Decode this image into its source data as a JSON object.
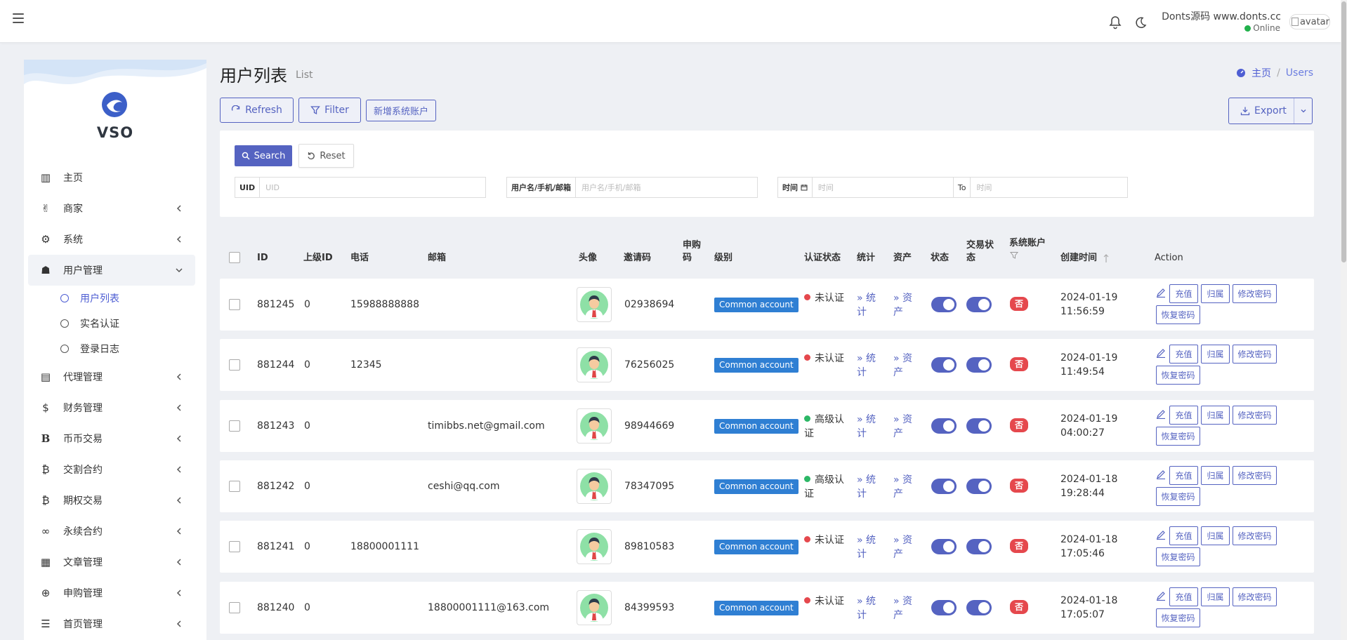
{
  "topbar": {
    "user_name": "Donts源码 www.donts.cc",
    "status": "Online",
    "avatar_alt": "avatar"
  },
  "sidebar": {
    "brand": "VSO",
    "items": [
      {
        "label": "主页",
        "icon": "chart-bar-icon",
        "glyph": "▥",
        "chevron": false
      },
      {
        "label": "商家",
        "icon": "handshake-icon",
        "glyph": "✌",
        "chevron": true
      },
      {
        "label": "系统",
        "icon": "gear-icon",
        "glyph": "⚙",
        "chevron": true
      },
      {
        "label": "用户管理",
        "icon": "users-icon",
        "glyph": "☗",
        "chevron": true,
        "expanded": true
      },
      {
        "label": "代理管理",
        "icon": "id-card-icon",
        "glyph": "▤",
        "chevron": true
      },
      {
        "label": "财务管理",
        "icon": "dollar-icon",
        "glyph": "$",
        "chevron": true
      },
      {
        "label": "币币交易",
        "icon": "bitcoin-b-icon",
        "glyph": "B",
        "chevron": true
      },
      {
        "label": "交割合约",
        "icon": "bitcoin-icon",
        "glyph": "₿",
        "chevron": true
      },
      {
        "label": "期权交易",
        "icon": "bitcoin-icon",
        "glyph": "₿",
        "chevron": true
      },
      {
        "label": "永续合约",
        "icon": "link-icon",
        "glyph": "∞",
        "chevron": true
      },
      {
        "label": "文章管理",
        "icon": "newspaper-icon",
        "glyph": "▦",
        "chevron": true
      },
      {
        "label": "申购管理",
        "icon": "lifebuoy-icon",
        "glyph": "⊕",
        "chevron": true
      },
      {
        "label": "首页管理",
        "icon": "list-icon",
        "glyph": "☰",
        "chevron": true
      }
    ],
    "submenu": [
      {
        "label": "用户列表",
        "active": true
      },
      {
        "label": "实名认证",
        "active": false
      },
      {
        "label": "登录日志",
        "active": false
      }
    ]
  },
  "header": {
    "title": "用户列表",
    "subtitle": "List",
    "breadcrumb_home": "主页",
    "breadcrumb_current": "Users"
  },
  "toolbar": {
    "refresh": "Refresh",
    "filter": "Filter",
    "new_system_account": "新增系统账户",
    "export": "Export"
  },
  "search": {
    "search_btn": "Search",
    "reset_btn": "Reset",
    "uid_label": "UID",
    "uid_placeholder": "UID",
    "user_label": "用户名/手机/邮箱",
    "user_placeholder": "用户名/手机/邮箱",
    "time_label": "时间",
    "time_placeholder": "时间",
    "to_label": "To",
    "to_placeholder": "时间"
  },
  "table": {
    "headers": {
      "id": "ID",
      "parent_id": "上级ID",
      "phone": "电话",
      "email": "邮箱",
      "avatar": "头像",
      "invite": "邀请码",
      "purchase": "申购码",
      "level": "级别",
      "auth": "认证状态",
      "stats": "统计",
      "assets": "资产",
      "status": "状态",
      "trade_status": "交易状态",
      "sys_account": "系统账户",
      "created": "创建时间",
      "action": "Action"
    },
    "actions": {
      "recharge": "充值",
      "belong": "归属",
      "change_pwd": "修改密码",
      "restore_pwd": "恢复密码",
      "stats": "统计",
      "assets": "资产"
    },
    "rows": [
      {
        "id": "881245",
        "parent": "0",
        "phone": "15988888888",
        "email": "",
        "invite": "02938694",
        "level": "Common account",
        "auth": "未认证",
        "auth_color": "#e5484d",
        "sys": "否",
        "date": "2024-01-19",
        "time": "11:56:59"
      },
      {
        "id": "881244",
        "parent": "0",
        "phone": "12345",
        "email": "",
        "invite": "76256025",
        "level": "Common account",
        "auth": "未认证",
        "auth_color": "#e5484d",
        "sys": "否",
        "date": "2024-01-19",
        "time": "11:49:54"
      },
      {
        "id": "881243",
        "parent": "0",
        "phone": "",
        "email": "timibbs.net@gmail.com",
        "invite": "98944669",
        "level": "Common account",
        "auth": "高级认证",
        "auth_color": "#2cb766",
        "sys": "否",
        "date": "2024-01-19",
        "time": "04:00:27"
      },
      {
        "id": "881242",
        "parent": "0",
        "phone": "",
        "email": "ceshi@qq.com",
        "invite": "78347095",
        "level": "Common account",
        "auth": "高级认证",
        "auth_color": "#2cb766",
        "sys": "否",
        "date": "2024-01-18",
        "time": "19:28:44"
      },
      {
        "id": "881241",
        "parent": "0",
        "phone": "18800001111",
        "email": "",
        "invite": "89810583",
        "level": "Common account",
        "auth": "未认证",
        "auth_color": "#e5484d",
        "sys": "否",
        "date": "2024-01-18",
        "time": "17:05:46"
      },
      {
        "id": "881240",
        "parent": "0",
        "phone": "",
        "email": "18800001111@163.com",
        "invite": "84399593",
        "level": "Common account",
        "auth": "未认证",
        "auth_color": "#e5484d",
        "sys": "否",
        "date": "2024-01-18",
        "time": "17:05:07"
      }
    ]
  },
  "colors": {
    "accent": "#5563c1",
    "badge_blue": "#2f7fd3",
    "danger": "#e5484d",
    "success": "#2cb766"
  }
}
